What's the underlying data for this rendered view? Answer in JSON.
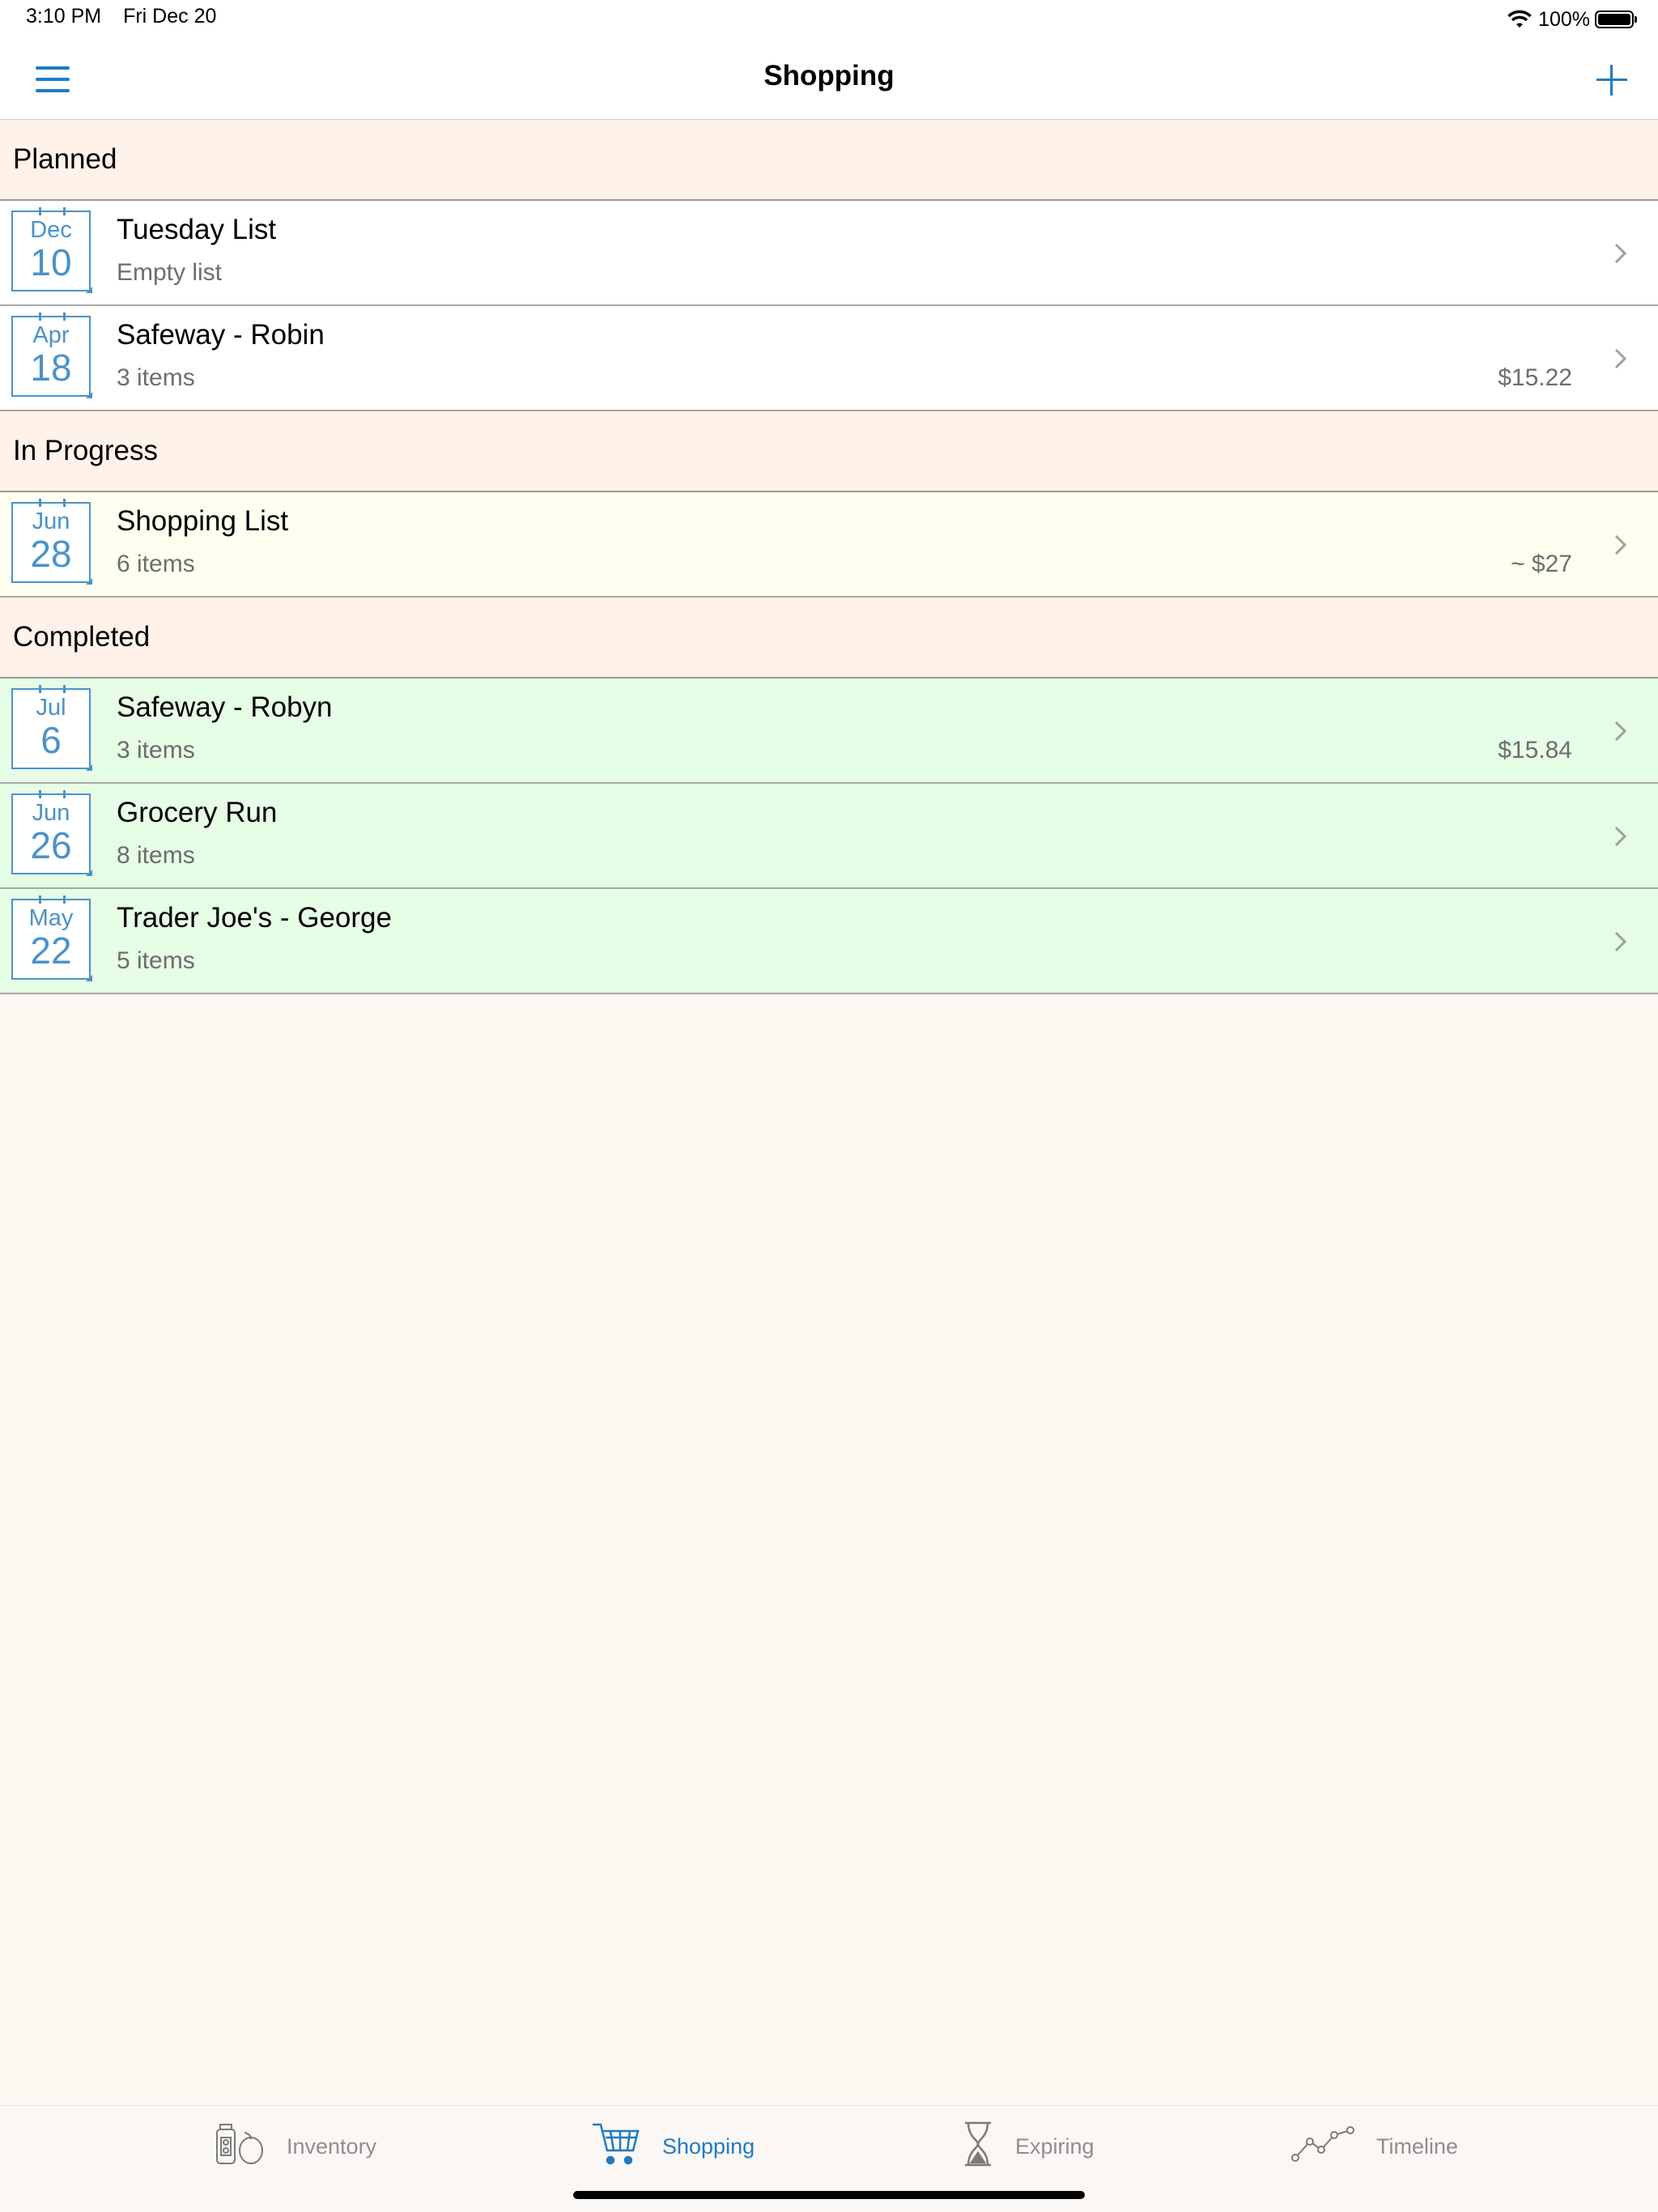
{
  "status_bar": {
    "time": "3:10 PM",
    "date": "Fri Dec 20",
    "battery": "100%"
  },
  "nav": {
    "title": "Shopping",
    "menu_icon": "hamburger-icon",
    "add_icon": "plus-icon"
  },
  "colors": {
    "accent": "#1f7bc4",
    "planned_row": "#ffffff",
    "in_progress_row": "#fffff0",
    "completed_row": "#e6fde6",
    "section_header": "#fff2e9"
  },
  "sections": [
    {
      "title": "Planned",
      "lists": [
        {
          "month": "Dec",
          "day": "10",
          "title": "Tuesday List",
          "subtitle": "Empty list",
          "price": ""
        },
        {
          "month": "Apr",
          "day": "18",
          "title": "Safeway - Robin",
          "subtitle": "3 items",
          "price": "$15.22"
        }
      ]
    },
    {
      "title": "In Progress",
      "lists": [
        {
          "month": "Jun",
          "day": "28",
          "title": "Shopping List",
          "subtitle": "6 items",
          "price": "~ $27"
        }
      ]
    },
    {
      "title": "Completed",
      "lists": [
        {
          "month": "Jul",
          "day": "6",
          "title": "Safeway - Robyn",
          "subtitle": "3 items",
          "price": "$15.84"
        },
        {
          "month": "Jun",
          "day": "26",
          "title": "Grocery Run",
          "subtitle": "8 items",
          "price": ""
        },
        {
          "month": "May",
          "day": "22",
          "title": "Trader Joe's - George",
          "subtitle": "5 items",
          "price": ""
        }
      ]
    }
  ],
  "tabs": [
    {
      "label": "Inventory",
      "icon": "inventory-icon",
      "active": false
    },
    {
      "label": "Shopping",
      "icon": "cart-icon",
      "active": true
    },
    {
      "label": "Expiring",
      "icon": "hourglass-icon",
      "active": false
    },
    {
      "label": "Timeline",
      "icon": "timeline-icon",
      "active": false
    }
  ]
}
